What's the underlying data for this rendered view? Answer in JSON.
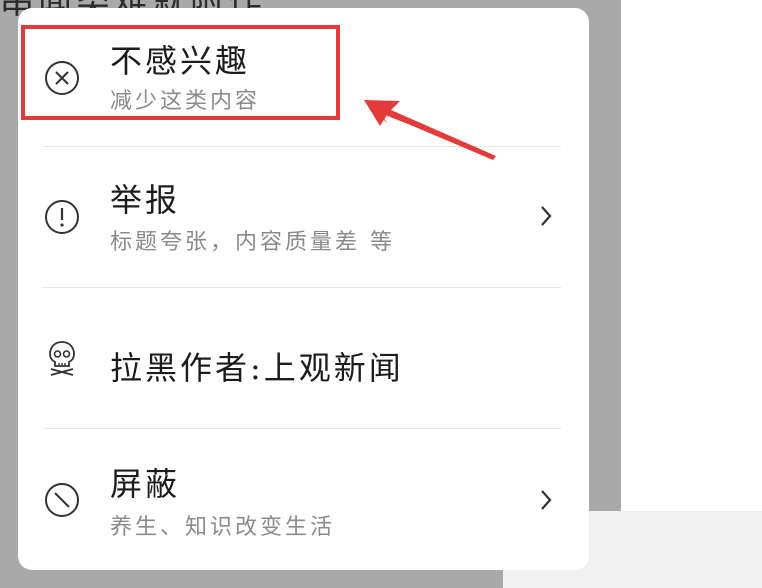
{
  "background": {
    "header_text": "串闻类难就附作"
  },
  "menu": {
    "items": [
      {
        "icon": "close-circle-icon",
        "title": "不感兴趣",
        "subtitle": "减少这类内容",
        "has_chevron": false
      },
      {
        "icon": "exclamation-circle-icon",
        "title": "举报",
        "subtitle": "标题夸张，内容质量差 等",
        "has_chevron": true
      },
      {
        "icon": "skull-icon",
        "title": "拉黑作者:上观新闻",
        "subtitle": "",
        "has_chevron": false
      },
      {
        "icon": "block-circle-icon",
        "title": "屏蔽",
        "subtitle": "养生、知识改变生活",
        "has_chevron": true
      }
    ]
  },
  "annotation": {
    "highlight_color": "#e33a3a"
  }
}
